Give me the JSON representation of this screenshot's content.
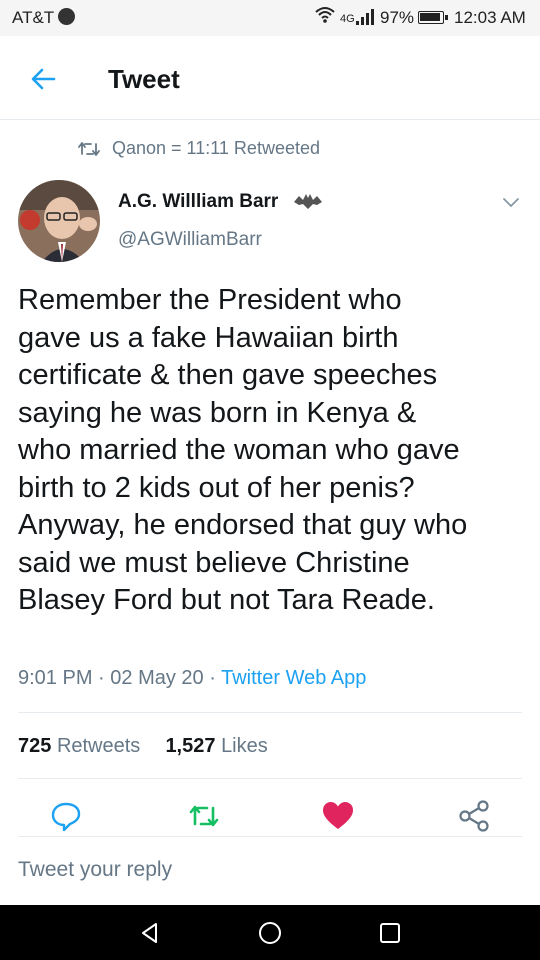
{
  "status_bar": {
    "carrier": "AT&T",
    "battery": "97%",
    "time": "12:03 AM"
  },
  "header": {
    "title": "Tweet"
  },
  "retweet": {
    "text": "Qanon = 11:11 Retweeted"
  },
  "author": {
    "name": "A.G. Willliam Barr",
    "handle": "@AGWilliamBarr"
  },
  "tweet": {
    "lines": [
      "Remember the President who",
      "gave us a fake Hawaiian birth",
      "certificate & then gave speeches",
      "saying he was born in Kenya &",
      "who married the woman who gave",
      "birth to 2 kids out of her penis?",
      "Anyway, he endorsed that guy who",
      "said we must believe Christine",
      "Blasey Ford but not Tara Reade."
    ],
    "time": "9:01 PM",
    "date": "02 May 20",
    "separator": "·",
    "source": "Twitter Web App"
  },
  "stats": {
    "retweets_count": "725",
    "retweets_label": "Retweets",
    "likes_count": "1,527",
    "likes_label": "Likes"
  },
  "reply": {
    "placeholder": "Tweet your reply"
  },
  "colors": {
    "accent": "#1da1f2",
    "retweet_green": "#17bf63",
    "like_red": "#e0245e",
    "muted": "#657786"
  },
  "icons": {
    "back": "arrow-left-icon",
    "reply": "reply-bubble-icon",
    "retweet": "retweet-icon",
    "like": "heart-icon",
    "share": "share-icon"
  }
}
